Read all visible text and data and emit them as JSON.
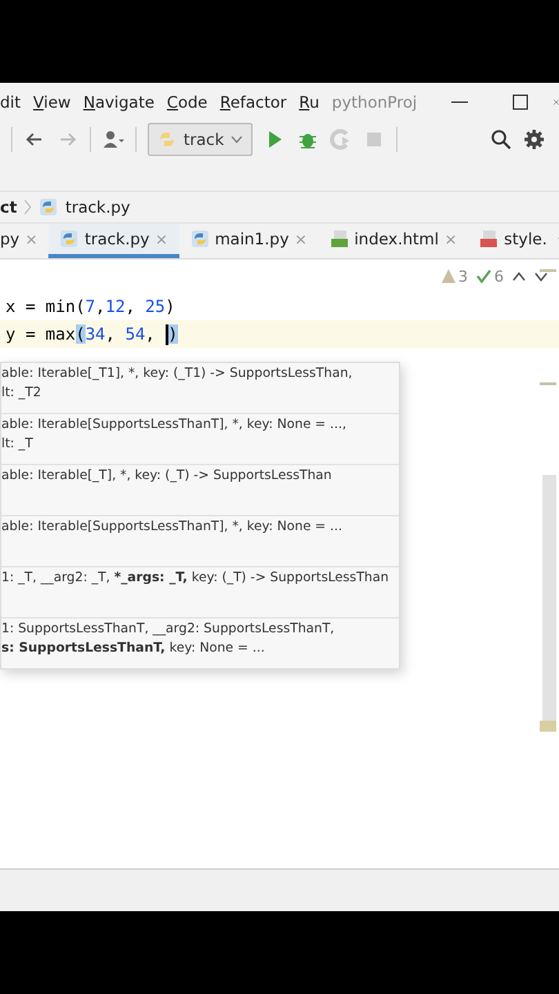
{
  "menu": [
    {
      "label": "dit",
      "mnemonic": false
    },
    {
      "label": "View",
      "mnemonic": true
    },
    {
      "label": "Navigate",
      "mnemonic": true
    },
    {
      "label": "Code",
      "mnemonic": true
    },
    {
      "label": "Refactor",
      "mnemonic": true
    },
    {
      "label": "Ru",
      "mnemonic": true
    }
  ],
  "window": {
    "title": "pythonProj"
  },
  "toolbar": {
    "run_config": "track",
    "back_disabled": false,
    "forward_disabled": true,
    "coverage_disabled": true,
    "stop_disabled": true
  },
  "breadcrumb": {
    "project": "ct",
    "file": "track.py"
  },
  "tabs": [
    {
      "label": "py",
      "kind": "none",
      "selected": false,
      "close": "×"
    },
    {
      "label": "track.py",
      "kind": "python",
      "selected": true,
      "close": "×"
    },
    {
      "label": "main1.py",
      "kind": "python",
      "selected": false,
      "close": "×"
    },
    {
      "label": "index.html",
      "kind": "html",
      "selected": false,
      "close": "×"
    },
    {
      "label": "style.",
      "kind": "css",
      "selected": false
    }
  ],
  "inspections": {
    "warnings": "3",
    "checks": "6"
  },
  "code": [
    {
      "current": false,
      "tokens": [
        {
          "kind": "text",
          "text": "x = min("
        },
        {
          "kind": "number",
          "text": "7"
        },
        {
          "kind": "text",
          "text": ","
        },
        {
          "kind": "number",
          "text": "12"
        },
        {
          "kind": "text",
          "text": ", "
        },
        {
          "kind": "number",
          "text": "25"
        },
        {
          "kind": "text",
          "text": ")"
        }
      ]
    },
    {
      "current": true,
      "tokens": [
        {
          "kind": "text",
          "text": "y = max"
        },
        {
          "kind": "bracket",
          "text": "("
        },
        {
          "kind": "number",
          "text": "34"
        },
        {
          "kind": "text",
          "text": ", "
        },
        {
          "kind": "number",
          "text": "54"
        },
        {
          "kind": "text",
          "text": ", "
        },
        {
          "kind": "caret"
        },
        {
          "kind": "bracket",
          "text": ")"
        }
      ]
    }
  ],
  "hints": [
    {
      "lines": [
        "able: Iterable[_T1], *, key: (_T1) -> SupportsLessThan,",
        "lt: _T2"
      ]
    },
    {
      "lines": [
        "able: Iterable[SupportsLessThanT], *, key: None = ...,",
        "lt: _T"
      ]
    },
    {
      "lines": [
        "able: Iterable[_T], *, key: (_T) -> SupportsLessThan"
      ]
    },
    {
      "lines": [
        "able: Iterable[SupportsLessThanT], *, key: None = ..."
      ]
    },
    {
      "lines": [
        "1: _T, __arg2: _T, ***_args: _T,** key: (_T) -> SupportsLessThan"
      ]
    },
    {
      "lines": [
        "1: SupportsLessThanT, __arg2: SupportsLessThanT,",
        "**s: SupportsLessThanT,** key: None = ..."
      ]
    }
  ]
}
